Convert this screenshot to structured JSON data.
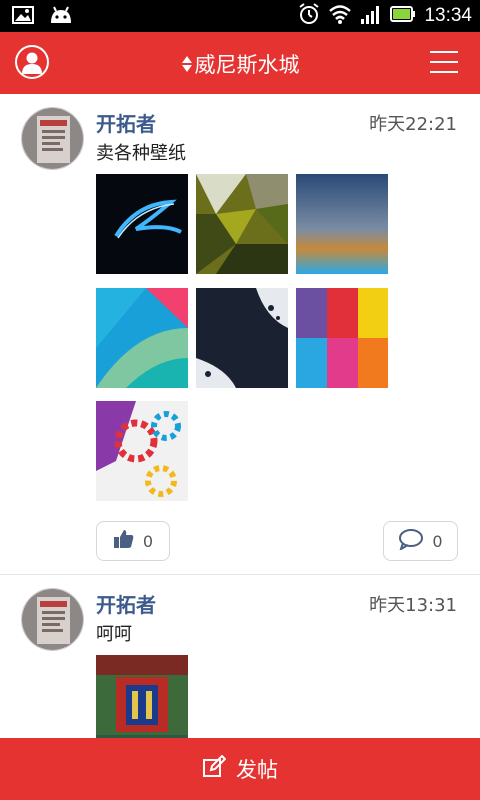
{
  "status_bar": {
    "time": "13:34",
    "icons": [
      "image-icon",
      "android-icon",
      "alarm-icon",
      "wifi-icon",
      "signal-icon",
      "battery-icon"
    ]
  },
  "header": {
    "title": "威尼斯水城",
    "left_icon": "user-icon",
    "right_icon": "menu-icon",
    "title_icon": "sort-icon"
  },
  "posts": [
    {
      "author": "开拓者",
      "time": "昨天22:21",
      "text": "卖各种壁纸",
      "image_count": 7,
      "likes": "0",
      "comments": "0"
    },
    {
      "author": "开拓者",
      "time": "昨天13:31",
      "text": "呵呵",
      "image_count": 1
    }
  ],
  "bottom_bar": {
    "label": "发帖",
    "icon": "edit-icon"
  },
  "colors": {
    "brand": "#e53332",
    "author": "#3c5a8c"
  }
}
